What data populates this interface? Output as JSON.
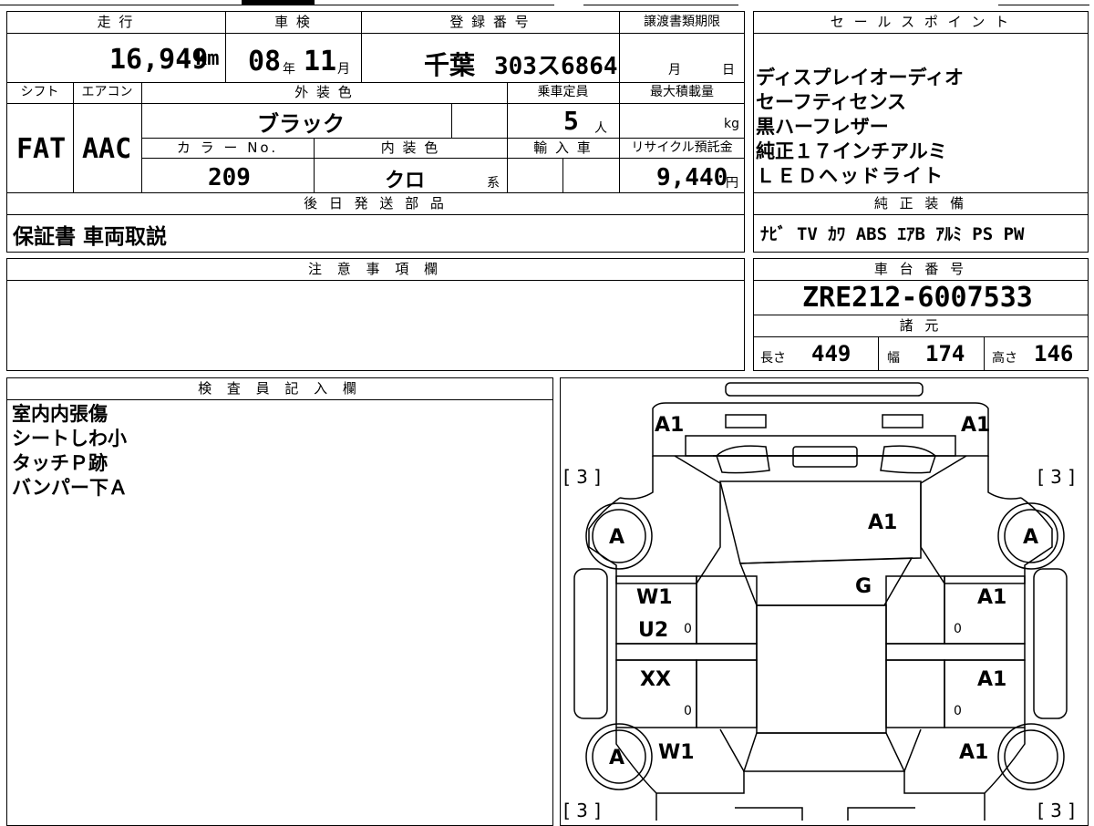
{
  "header": {
    "mileage_label": "走 行",
    "inspection_label": "車 検",
    "registration_label": "登 録 番 号",
    "transfer_deadline_label": "譲渡書類期限",
    "sales_points_label": "セ ー ル ス ポ イ ン ト"
  },
  "vehicle": {
    "mileage": "16,949",
    "mileage_unit": "km",
    "inspection_year": "08",
    "year_unit": "年",
    "inspection_month": "11",
    "month_unit": "月",
    "plate_region": "千葉",
    "plate_number": "303ス6864",
    "deadline_month_unit": "月",
    "deadline_day_unit": "日",
    "shift_label": "シフト",
    "ac_label": "エアコン",
    "exterior_color_label": "外 装 色",
    "capacity_label": "乗車定員",
    "max_load_label": "最大積載量",
    "shift": "FAT",
    "ac": "AAC",
    "exterior_color": "ブラック",
    "capacity": "5",
    "capacity_unit": "人",
    "max_load_unit": "kg",
    "color_no_label": "カ ラ ー No.",
    "interior_color_label": "内 装 色",
    "import_label": "輸 入 車",
    "recycle_label": "リサイクル預託金",
    "color_no": "209",
    "interior_color": "クロ",
    "interior_suffix": "系",
    "recycle_fee": "9,440",
    "recycle_unit": "円",
    "later_parts_label": "後 日 発 送 部 品",
    "later_parts": "保証書 車両取説"
  },
  "sales_points": [
    "ディスプレイオーディオ",
    "セーフティセンス",
    "黒ハーフレザー",
    "純正１７インチアルミ",
    "ＬＥＤヘッドライト"
  ],
  "equipment": {
    "label": "純 正 装 備",
    "items": "ﾅﾋﾞ TV ｶﾜ ABS ｴｱB ｱﾙﾐ PS PW"
  },
  "notes": {
    "label": "注 意 事 項 欄"
  },
  "chassis": {
    "label": "車 台 番 号",
    "number": "ZRE212-6007533",
    "specs_label": "諸 元",
    "length_label": "長さ",
    "length": "449",
    "width_label": "幅",
    "width": "174",
    "height_label": "高さ",
    "height": "146"
  },
  "inspector": {
    "label": "検 査 員 記 入 欄",
    "comments": [
      "室内内張傷",
      "シートしわ小",
      "タッチＰ跡",
      "バンパー下Ａ"
    ]
  },
  "diagram": {
    "marks": {
      "front_left_corner": "A1",
      "front_right_corner": "A1",
      "hood": "A1",
      "windshield": "G",
      "front_left_door": "W1",
      "front_left_door_2": "U2",
      "rear_left_door": "XX",
      "rear_left_fender": "W1",
      "front_right_door": "A1",
      "rear_right_door": "A1",
      "rear_right_fender": "A1",
      "wheel_fl": "A",
      "wheel_fr": "A",
      "wheel_rl": "A",
      "tire_fl": "[ 3 ]",
      "tire_fr": "[ 3 ]",
      "tire_rl": "[ 3 ]",
      "tire_rr": "[ 3 ]",
      "zero_1": "0",
      "zero_2": "0",
      "zero_3": "0",
      "zero_4": "0"
    }
  }
}
